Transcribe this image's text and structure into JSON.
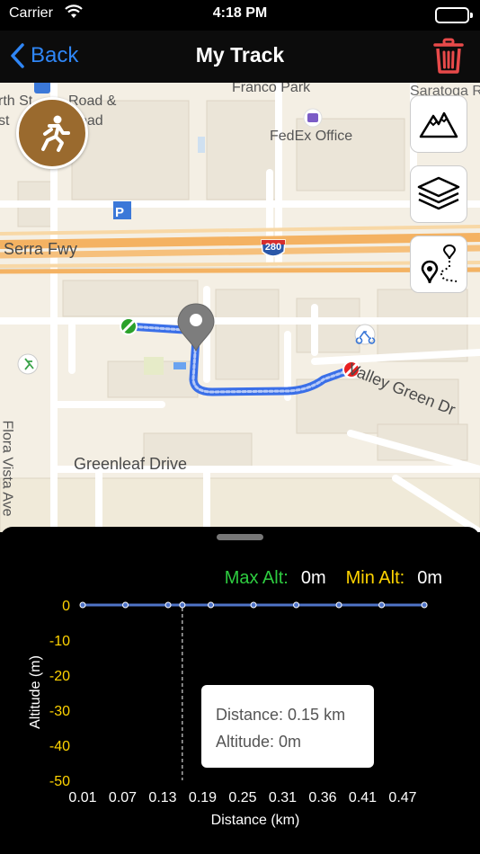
{
  "status": {
    "carrier": "Carrier",
    "time": "4:18 PM"
  },
  "nav": {
    "back_label": "Back",
    "title": "My Track"
  },
  "map": {
    "labels": {
      "franco_park": "Franco Park",
      "saratoga": "Saratoga Ro",
      "fedex": "FedEx Office",
      "road_and": "Road &",
      "oad": "oad",
      "th_st": "rth St",
      "st": "st",
      "serra": "Serra Fwy",
      "highway": "280",
      "valley_green": "Valley Green Dr",
      "greenleaf": "Greenleaf Drive",
      "flora": "Flora Vista Ave",
      "parking": "P"
    }
  },
  "stats": {
    "max_alt_label": "Max Alt:",
    "max_alt_value": "0m",
    "min_alt_label": "Min Alt:",
    "min_alt_value": "0m"
  },
  "chart_data": {
    "type": "line",
    "title": "",
    "xlabel": "Distance (km)",
    "ylabel": "Altitude (m)",
    "x_ticks": [
      "0.01",
      "0.07",
      "0.13",
      "0.19",
      "0.25",
      "0.31",
      "0.36",
      "0.41",
      "0.47"
    ],
    "y_ticks": [
      "0",
      "-10",
      "-20",
      "-30",
      "-40",
      "-50"
    ],
    "ylim": [
      -50,
      0
    ],
    "xlim": [
      0.01,
      0.5
    ],
    "series": [
      {
        "x": [
          0.01,
          0.07,
          0.13,
          0.15,
          0.19,
          0.25,
          0.31,
          0.37,
          0.43,
          0.49
        ],
        "y": [
          0,
          0,
          0,
          0,
          0,
          0,
          0,
          0,
          0,
          0
        ]
      }
    ],
    "line_color": "#4f74c8",
    "tick_color": "#ffd400",
    "highlight_x": 0.15
  },
  "tooltip": {
    "distance": "Distance: 0.15 km",
    "altitude": "Altitude: 0m"
  },
  "colors": {
    "accent": "#2f86f6",
    "trash": "#e84a4a",
    "track": "#3a6fe8",
    "activity": "#9a6a2e"
  }
}
